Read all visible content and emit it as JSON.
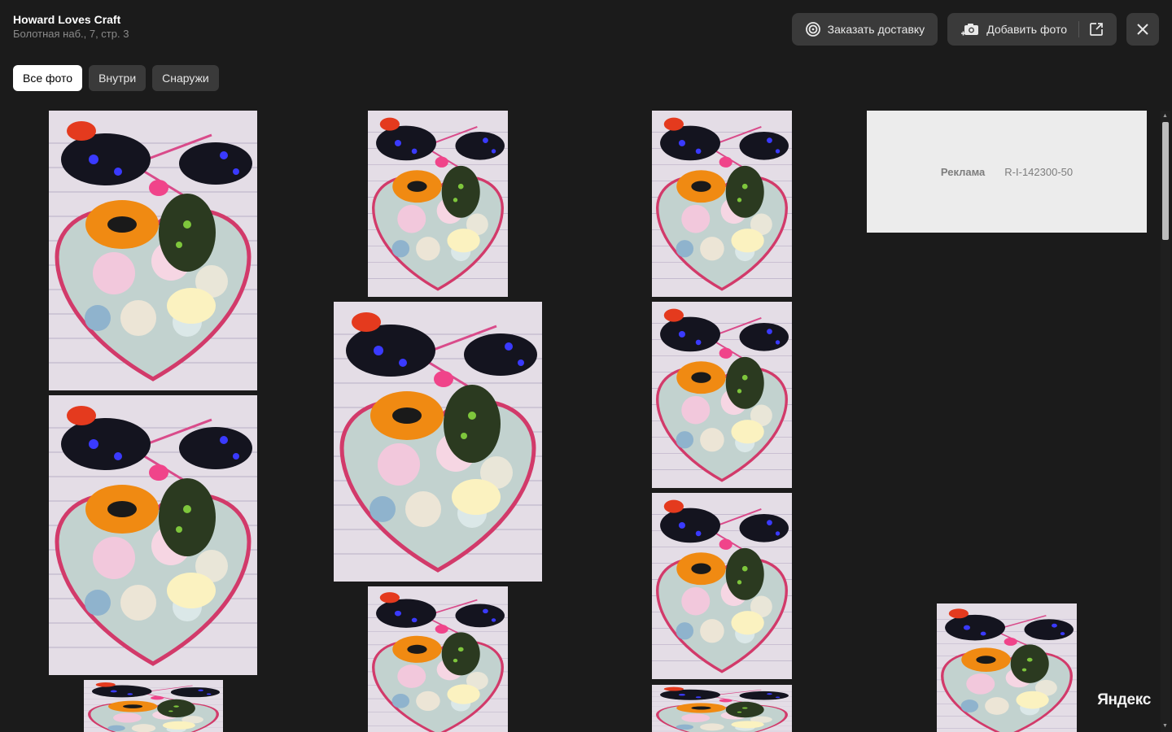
{
  "header": {
    "org_name": "Howard Loves Craft",
    "address": "Болотная наб., 7, стр. 3"
  },
  "actions": {
    "order_delivery": "Заказать доставку",
    "add_photo": "Добавить фото"
  },
  "tabs": [
    {
      "label": "Все фото",
      "active": true
    },
    {
      "label": "Внутри",
      "active": false
    },
    {
      "label": "Снаружи",
      "active": false
    }
  ],
  "ad": {
    "label": "Реклама",
    "id": "R-I-142300-50"
  },
  "watermark": "Яндекс",
  "colors": {
    "background": "#1b1b1b",
    "button": "#3a3a3a",
    "tab_active": "#ffffff",
    "ad_background": "#ececec"
  },
  "photo_subject": "butterflies-on-heart-flower-box"
}
